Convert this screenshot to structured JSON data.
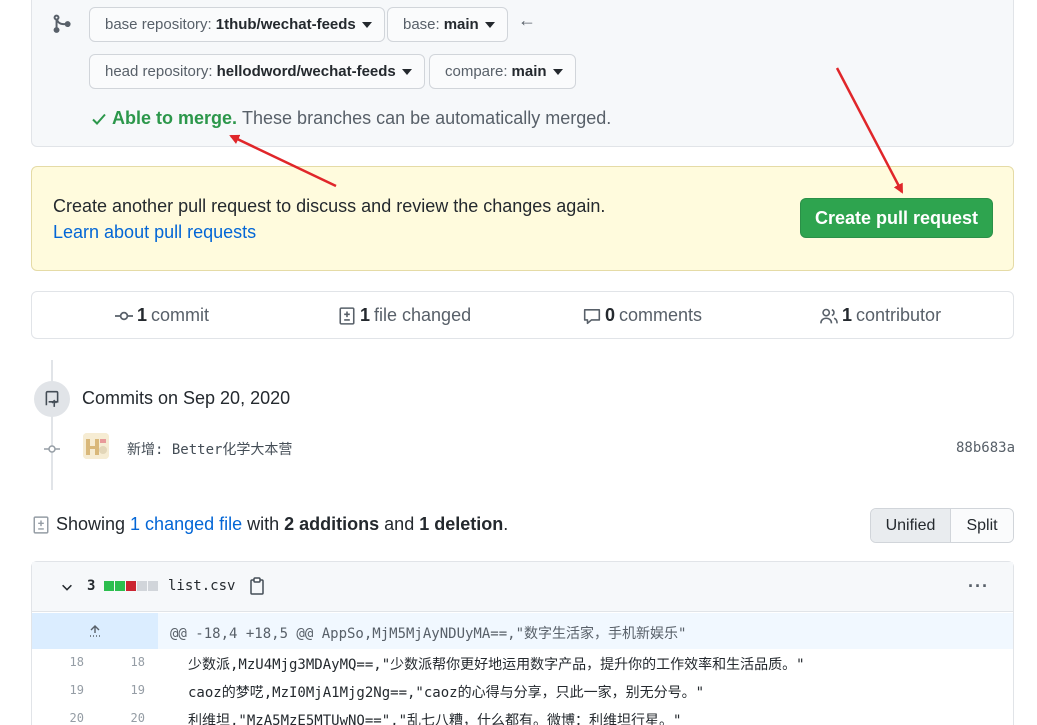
{
  "compare": {
    "base_repo_label": "base repository:",
    "base_repo_value": "1thub/wechat-feeds",
    "base_label": "base:",
    "base_value": "main",
    "head_repo_label": "head repository:",
    "head_repo_value": "hellodword/wechat-feeds",
    "compare_label": "compare:",
    "compare_value": "main",
    "merge_status": "Able to merge.",
    "merge_text": "These branches can be automatically merged."
  },
  "flash": {
    "text": "Create another pull request to discuss and review the changes again.",
    "link": "Learn about pull requests",
    "button": "Create pull request"
  },
  "stats": {
    "commits_count": "1",
    "commits_label": "commit",
    "files_count": "1",
    "files_label": "file changed",
    "comments_count": "0",
    "comments_label": "comments",
    "contributors_count": "1",
    "contributors_label": "contributor"
  },
  "commits": {
    "heading": "Commits on Sep 20, 2020",
    "message": "新增: Better化学大本营",
    "sha": "88b683a"
  },
  "showing": {
    "prefix": "Showing",
    "files_link": "1 changed file",
    "with": "with",
    "additions": "2 additions",
    "and": "and",
    "deletions": "1 deletion",
    "period": ".",
    "unified": "Unified",
    "split": "Split"
  },
  "file": {
    "changes": "3",
    "name": "list.csv",
    "menu": "···",
    "diffstat_colors": [
      "#2cbe4e",
      "#2cbe4e",
      "#cb2431",
      "#d1d5da",
      "#d1d5da"
    ],
    "hunk_header": "@@ -18,4 +18,5 @@ AppSo,MjM5MjAyNDUyMA==,\"数字生活家，手机新娱乐\"",
    "lines": [
      {
        "old": "18",
        "new": "18",
        "code": "少数派,MzU4Mjg3MDAyMQ==,\"少数派帮你更好地运用数字产品，提升你的工作效率和生活品质。\""
      },
      {
        "old": "19",
        "new": "19",
        "code": "caoz的梦呓,MzI0MjA1Mjg2Ng==,\"caoz的心得与分享，只此一家，别无分号。\""
      },
      {
        "old": "20",
        "new": "20",
        "code": "利维坦,\"MzA5MzE5MTUwNQ==\",\"乱七八糟，什么都有。微博：利维坦行星。\""
      }
    ]
  }
}
